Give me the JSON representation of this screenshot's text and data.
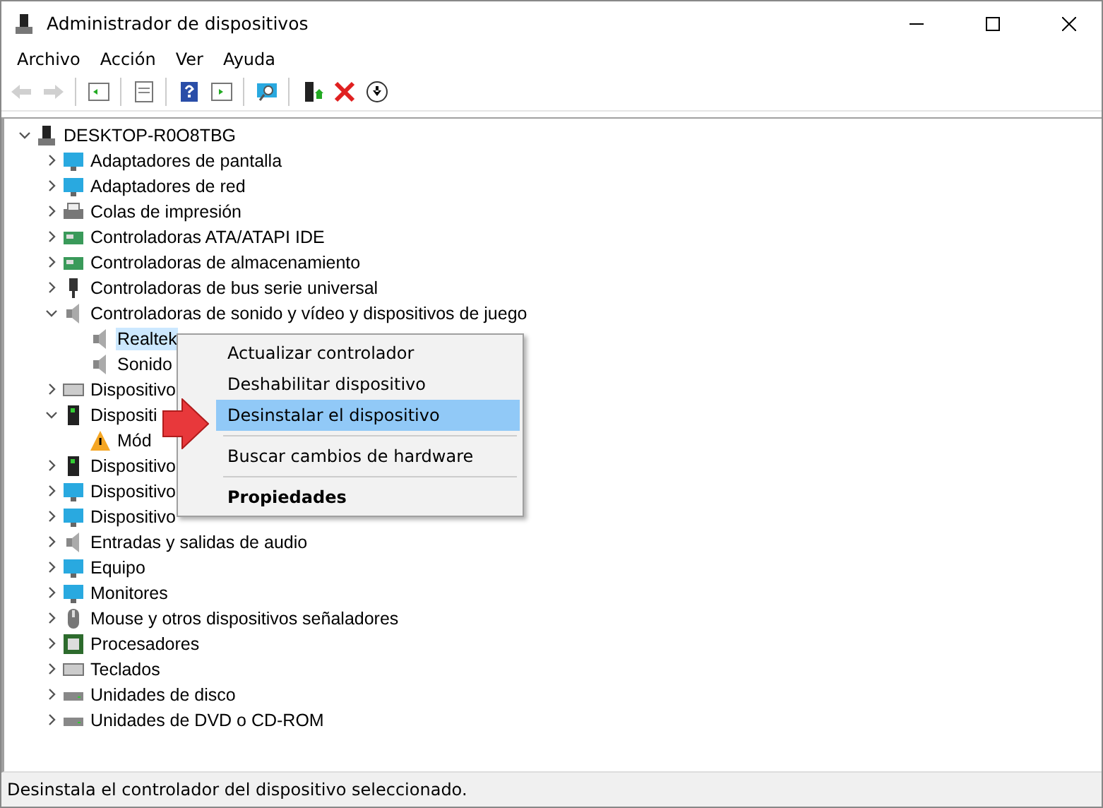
{
  "window": {
    "title": "Administrador de dispositivos"
  },
  "menu": [
    "Archivo",
    "Acción",
    "Ver",
    "Ayuda"
  ],
  "toolbar": [
    {
      "disabled": true
    },
    {
      "disabled": true
    },
    {
      "disabled": false
    },
    {
      "disabled": false
    },
    {
      "disabled": false
    },
    {
      "disabled": false
    },
    {
      "disabled": false
    },
    {
      "disabled": false
    },
    {
      "disabled": false
    },
    {
      "disabled": false
    }
  ],
  "tree": [
    {
      "label": "DESKTOP-R0O8TBG",
      "expanded": true,
      "selected": false,
      "children": [
        {
          "label": "Adaptadores de pantalla",
          "expanded": false,
          "selected": false
        },
        {
          "label": "Adaptadores de red",
          "expanded": false,
          "selected": false
        },
        {
          "label": "Colas de impresión",
          "expanded": false,
          "selected": false
        },
        {
          "label": "Controladoras ATA/ATAPI IDE",
          "expanded": false,
          "selected": false
        },
        {
          "label": "Controladoras de almacenamiento",
          "expanded": false,
          "selected": false
        },
        {
          "label": "Controladoras de bus serie universal",
          "expanded": false,
          "selected": false
        },
        {
          "label": "Controladoras de sonido y vídeo y dispositivos de juego",
          "expanded": true,
          "selected": false,
          "children": [
            {
              "label": "Realtek",
              "selected": true
            },
            {
              "label": "Sonido",
              "selected": false
            }
          ]
        },
        {
          "label": "Dispositivo",
          "expanded": false,
          "selected": false
        },
        {
          "label": "Dispositi",
          "expanded": true,
          "selected": false,
          "children": [
            {
              "label": "Mód",
              "selected": false,
              "warning": true
            }
          ]
        },
        {
          "label": "Dispositivo",
          "expanded": false,
          "selected": false
        },
        {
          "label": "Dispositivo",
          "expanded": false,
          "selected": false
        },
        {
          "label": "Dispositivo",
          "expanded": false,
          "selected": false
        },
        {
          "label": "Entradas y salidas de audio",
          "expanded": false,
          "selected": false
        },
        {
          "label": "Equipo",
          "expanded": false,
          "selected": false
        },
        {
          "label": "Monitores",
          "expanded": false,
          "selected": false
        },
        {
          "label": "Mouse y otros dispositivos señaladores",
          "expanded": false,
          "selected": false
        },
        {
          "label": "Procesadores",
          "expanded": false,
          "selected": false
        },
        {
          "label": "Teclados",
          "expanded": false,
          "selected": false
        },
        {
          "label": "Unidades de disco",
          "expanded": false,
          "selected": false
        },
        {
          "label": "Unidades de DVD o CD-ROM",
          "expanded": false,
          "selected": false
        }
      ]
    }
  ],
  "context_menu": [
    {
      "label": "Actualizar controlador",
      "selected": false,
      "separator_before": false,
      "default": false
    },
    {
      "label": "Deshabilitar dispositivo",
      "selected": false,
      "separator_before": false,
      "default": false
    },
    {
      "label": "Desinstalar el dispositivo",
      "selected": true,
      "separator_before": false,
      "default": false
    },
    {
      "label": "Buscar cambios de hardware",
      "selected": false,
      "separator_before": true,
      "default": false
    },
    {
      "label": "Propiedades",
      "selected": false,
      "separator_before": true,
      "default": true
    }
  ],
  "status_bar": "Desinstala el controlador del dispositivo seleccionado."
}
